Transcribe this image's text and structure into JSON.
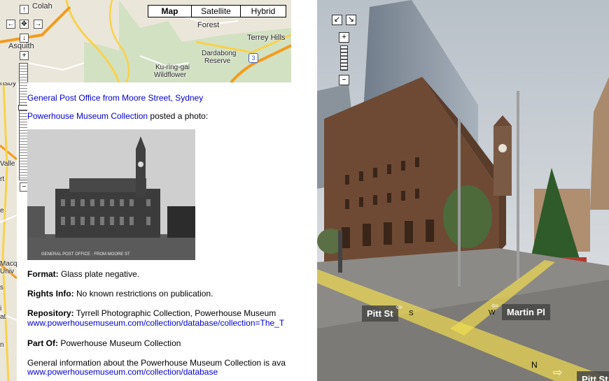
{
  "map": {
    "type_buttons": [
      "Map",
      "Satellite",
      "Hybrid"
    ],
    "labels": {
      "colah": "Colah",
      "forest": "Forest",
      "terrey_hills": "Terrey Hills",
      "asquith": "Asquith",
      "dardabong": "Dardabong",
      "reserve": "Reserve",
      "kuringgai": "Ku-ring-gai",
      "wildflower": "Wildflower",
      "route": "3",
      "edge_nsby": "nsby",
      "edge_valle": "Valle",
      "edge_rt": "rt",
      "edge_e": "e",
      "edge_macq": "Macq",
      "edge_univ": "Univ",
      "edge_s": "s",
      "edge_i": "i",
      "edge_at": "at",
      "edge_n": "n"
    },
    "controls": {
      "up": "↑",
      "left": "←",
      "center": "✥",
      "right": "→",
      "down": "↓",
      "zoom_in": "+",
      "zoom_out": "−"
    }
  },
  "info": {
    "title_link": "General Post Office from Moore Street, Sydney",
    "poster_link": "Powerhouse Museum Collection",
    "poster_suffix": " posted a photo:",
    "photo_caption": "GENERAL POST OFFICE · FROM MOORE ST",
    "format_label": "Format:",
    "format_value": " Glass plate negative.",
    "rights_label": "Rights Info:",
    "rights_value": " No known restrictions on publication.",
    "repository_label": "Repository:",
    "repository_value": " Tyrrell Photographic Collection, Powerhouse Museum",
    "repository_link": "www.powerhousemuseum.com/collection/database/collection=The_T",
    "partof_label": "Part Of:",
    "partof_value": " Powerhouse Museum Collection",
    "general_text": "General information about the Powerhouse Museum Collection is ava",
    "general_link": "www.powerhousemuseum.com/collection/database"
  },
  "streetview": {
    "label_pitt": "Pitt St",
    "label_martin": "Martin Pl",
    "label_pitt_bottom": "Pitt St",
    "dir_s": "S",
    "dir_w": "W",
    "dir_n": "N",
    "ctl_expand": "↙",
    "ctl_collapse": "↘",
    "ctl_zoom_in": "+",
    "ctl_zoom_out": "−"
  }
}
